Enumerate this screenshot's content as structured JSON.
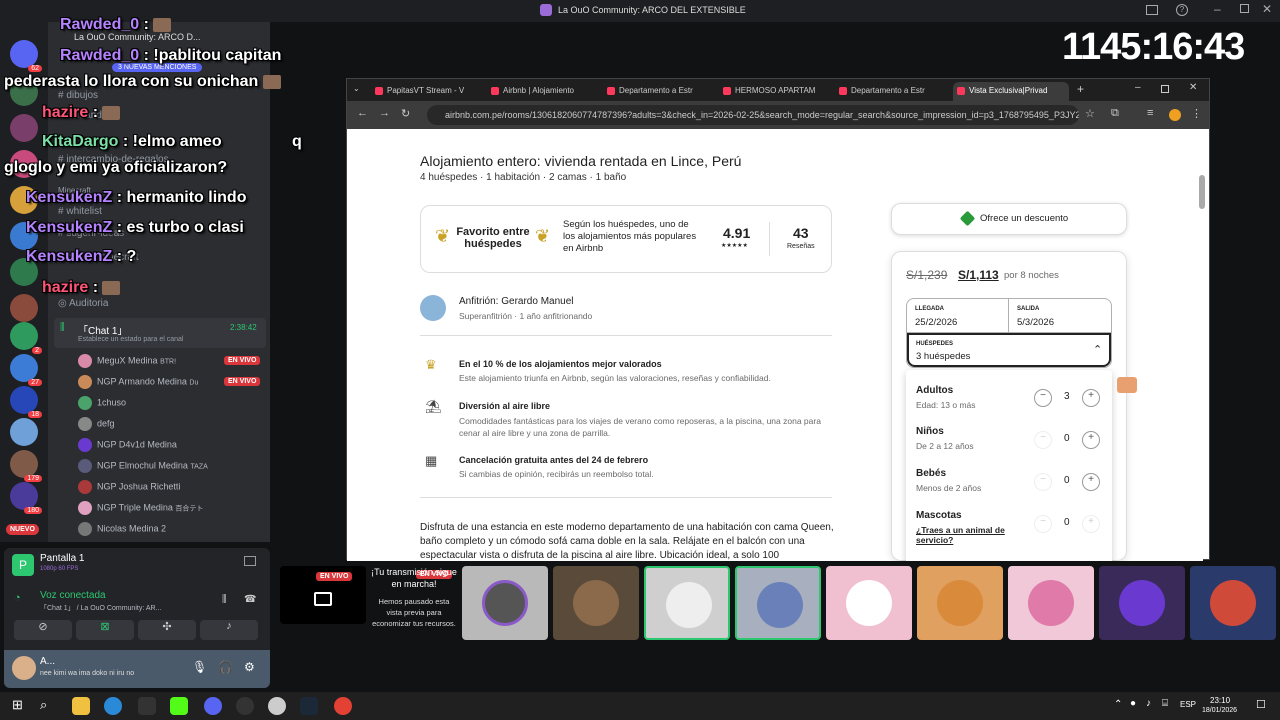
{
  "window": {
    "title": "La OuO Community: ARCO DEL EXTENSIBLE"
  },
  "timer": "1145:16:43",
  "server_badges": [
    "62",
    "2",
    "27",
    "18",
    "179",
    "180"
  ],
  "nuevo_label": "NUEVO",
  "mentions_pill": "3 NUEVAS MENCIONES",
  "channels": {
    "server_name": "La OuO Community: ARCO D...",
    "items": [
      "dibujos",
      "comandos",
      "intercambio-de-regalos",
      "Minecraft",
      "whitelist",
      "sugerir-ideas",
      "server-minecraft",
      "Auditoria"
    ],
    "voice_channel": "「Chat 1」",
    "voice_time": "2:38:42",
    "voice_status_placeholder": "Establece un estado para el canal",
    "members": [
      {
        "name": "MeguX Medina",
        "tag": "BTR!",
        "live": "EN VIVO"
      },
      {
        "name": "NGP Armando Medina",
        "tag": "Du",
        "live": "EN VIVO"
      },
      {
        "name": "1chuso",
        "tag": "",
        "live": ""
      },
      {
        "name": "defg",
        "tag": "",
        "live": ""
      },
      {
        "name": "NGP D4v1d Medina",
        "tag": "",
        "live": ""
      },
      {
        "name": "NGP Elmochul Medina",
        "tag": "TAZA",
        "live": ""
      },
      {
        "name": "NGP Joshua Richetti",
        "tag": "",
        "live": ""
      },
      {
        "name": "NGP Triple Medina",
        "tag": "百合テト",
        "live": ""
      },
      {
        "name": "Nicolas Medina 2",
        "tag": "",
        "live": ""
      }
    ]
  },
  "chat": [
    {
      "user": "Rawded_0",
      "text": ":"
    },
    {
      "user": "Rawded_0",
      "text": ": !pablitou capitan"
    },
    {
      "user": "",
      "text": "pederasta lo llora con su onichan"
    },
    {
      "user": "hazire",
      "text": ":"
    },
    {
      "user": "KitaDargo",
      "text": ": !elmo ameo"
    },
    {
      "user": "",
      "text": "q"
    },
    {
      "user": "",
      "text": "gloglo y emi ya oficializaron?"
    },
    {
      "user": "KensukenZ",
      "text": ": hermanito lindo"
    },
    {
      "user": "KensukenZ",
      "text": ": es turbo o clasi"
    },
    {
      "user": "KensukenZ",
      "text": ": ?"
    },
    {
      "user": "hazire",
      "text": ":"
    }
  ],
  "voice_panel": {
    "screen_title": "Pantalla 1",
    "screen_sub": "1080p 60 FPS",
    "connected": "Voz conectada",
    "connected_sub": "「Chat 1」 / La OuO Community: AR...",
    "user_name": "A...",
    "user_status": "nee kimi wa ima doko ni iru no"
  },
  "browser": {
    "tabs": [
      "PapitasVT Stream - V",
      "Airbnb | Alojamiento",
      "Departamento a Estr",
      "HERMOSO APARTAM",
      "Departamento a Estr",
      "Vista Exclusiva|Privad"
    ],
    "url": "airbnb.com.pe/rooms/1306182060774787396?adults=3&check_in=2026-02-25&search_mode=regular_search&source_impression_id=p3_1768795495_P3JY21..."
  },
  "listing": {
    "title": "Alojamiento entero: vivienda rentada en Lince, Perú",
    "subtitle": "4 huéspedes · 1 habitación · 2 camas · 1 baño",
    "fav_label": "Favorito entre huéspedes",
    "fav_desc": "Según los huéspedes, uno de los alojamientos más populares en Airbnb",
    "rating": "4.91",
    "stars": "★★★★★",
    "reviews": "43",
    "reviews_label": "Reseñas",
    "host_title": "Anfitrión: Gerardo Manuel",
    "host_sub": "Superanfitrión · 1 año anfitrionando",
    "features": [
      {
        "title": "En el 10 % de los alojamientos mejor valorados",
        "desc": "Este alojamiento triunfa en Airbnb, según las valoraciones, reseñas y confiabilidad."
      },
      {
        "title": "Diversión al aire libre",
        "desc": "Comodidades fantásticas para los viajes de verano como reposeras, a la piscina, una zona para cenar al aire libre y una zona de parrilla."
      },
      {
        "title": "Cancelación gratuita antes del 24 de febrero",
        "desc": "Si cambias de opinión, recibirás un reembolso total."
      }
    ],
    "description": "Disfruta de una estancia en este moderno departamento de una habitación con cama Queen, baño completo y un cómodo sofá cama doble en la sala. Relájate en el balcón con una espectacular vista o disfruta de la piscina al aire libre. Ubicación ideal, a solo 100"
  },
  "booking": {
    "discount": "Ofrece un descuento",
    "old_price": "S/1,239",
    "new_price": "S/1,113",
    "per": "por 8 noches",
    "checkin_label": "LLEGADA",
    "checkin": "25/2/2026",
    "checkout_label": "SALIDA",
    "checkout": "5/3/2026",
    "guests_label": "HUÉSPEDES",
    "guests": "3 huéspedes",
    "guest_rows": [
      {
        "title": "Adultos",
        "sub": "Edad: 13 o más",
        "count": "3"
      },
      {
        "title": "Niños",
        "sub": "De 2 a 12 años",
        "count": "0"
      },
      {
        "title": "Bebés",
        "sub": "Menos de 2 años",
        "count": "0"
      },
      {
        "title": "Mascotas",
        "sub": "¿Traes a un animal de servicio?",
        "count": "0"
      }
    ]
  },
  "stream": {
    "live": "EN VIVO",
    "paused_title": "¡Tu transmisión sigue en marcha!",
    "paused_desc": "Hemos pausado esta vista previa para economizar tus recursos."
  },
  "taskbar": {
    "lang": "ESP",
    "time": "23:10",
    "date": "18/01/2026"
  },
  "colors": {
    "airbnb": "#ff385c",
    "discord_live": "#da373c",
    "discord_bg": "#2b2d31"
  }
}
